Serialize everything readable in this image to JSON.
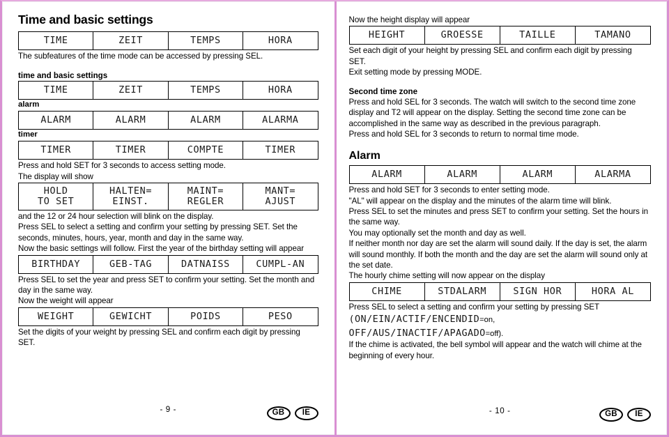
{
  "theme": {
    "page_border_color": "#d98fd2",
    "text_color": "#000000",
    "lcd_text_color": "#1a1a1a"
  },
  "left_page": {
    "title": "Time and basic settings",
    "lcd_top": {
      "cells": [
        "TIME",
        "ZEIT",
        "TEMPS",
        "HORA"
      ]
    },
    "intro": "The subfeatures of the time mode can be accessed by pressing SEL.",
    "mode_groups": [
      {
        "label": "time and basic settings",
        "cells": [
          "TIME",
          "ZEIT",
          "TEMPS",
          "HORA"
        ]
      },
      {
        "label": "alarm",
        "cells": [
          "ALARM",
          "ALARM",
          "ALARM",
          "ALARMA"
        ]
      },
      {
        "label": "timer",
        "cells": [
          "TIMER",
          "TIMER",
          "COMPTE",
          "TIMER"
        ]
      }
    ],
    "access_note": "Press and hold SET for 3 seconds to access setting mode.",
    "display_will_show_label": "The display will show",
    "lcd_hold": {
      "cells": [
        "HOLD\nTO SET",
        "HALTEN=\nEINST.",
        "MAINT=\nREGLER",
        "MANT=\nAJUST"
      ]
    },
    "after_hold_text": "and the 12 or 24 hour selection will blink on the display.\nPress SEL to select a setting and confirm your setting by pressing SET. Set the seconds, minutes, hours, year, month and day in the same way.",
    "birthday_intro": "Now the basic settings will follow. First the year of the birthday setting will appear",
    "lcd_birthday": {
      "cells": [
        "BIRTHDAY",
        "GEB-TAG",
        "DATNAISS",
        "CUMPL-AN"
      ]
    },
    "birthday_note": "Press SEL to set the year and press SET to confirm your setting. Set the month and day in the same way.",
    "weight_intro": "Now the weight will appear",
    "lcd_weight": {
      "cells": [
        "WEIGHT",
        "GEWICHT",
        "POIDS",
        "PESO"
      ]
    },
    "weight_note": "Set the digits of your weight by pressing SEL and confirm each digit by pressing SET.",
    "footer": {
      "folio": "- 9 -",
      "badges": [
        "GB",
        "IE"
      ]
    }
  },
  "right_page": {
    "height_intro": "Now the height display will appear",
    "lcd_height": {
      "cells": [
        "HEIGHT",
        "GROESSE",
        "TAILLE",
        "TAMANO"
      ]
    },
    "height_note": "Set each digit of your height by pressing SEL and confirm each digit by pressing SET.\nExit setting mode by pressing MODE.",
    "second_time_zone": {
      "title": "Second time zone",
      "body": "Press and hold SEL for 3 seconds. The watch will switch to the second time zone display and T2 will appear on the display. Setting the second time zone can be accomplished in the same way as described in the previous paragraph.\nPress and hold SEL for 3 seconds to return to normal time mode."
    },
    "alarm": {
      "title": "Alarm",
      "lcd": {
        "cells": [
          "ALARM",
          "ALARM",
          "ALARM",
          "ALARMA"
        ]
      },
      "body": "Press and hold SET for 3 seconds to enter setting mode.\n\"AL\" will appear on the display and the minutes of the alarm time will blink.\nPress SEL to set the minutes and press SET to confirm your setting. Set the hours in the same way.\nYou may optionally set the month and day as well.\nIf neither month nor day are set the alarm will sound daily. If the day is set, the alarm will sound monthly. If both the month and the day are set the alarm will sound only at the set date."
    },
    "chime": {
      "intro": "The hourly chime setting will now appear on the display",
      "lcd": {
        "cells": [
          "CHIME",
          "STDALARM",
          "SIGN HOR",
          "HORA AL"
        ]
      },
      "select_note": "Press SEL to select a setting and confirm your setting by pressing SET",
      "on_codes": "(ON/EIN/ACTIF/ENCENDID",
      "on_suffix": "=on,",
      "off_codes": "OFF/AUS/INACTIF/APAGADO",
      "off_suffix": "=off).",
      "closing": "If the chime is activated, the bell symbol will appear and the watch will chime at the beginning of every hour."
    },
    "footer": {
      "folio": "- 10 -",
      "badges": [
        "GB",
        "IE"
      ]
    }
  }
}
